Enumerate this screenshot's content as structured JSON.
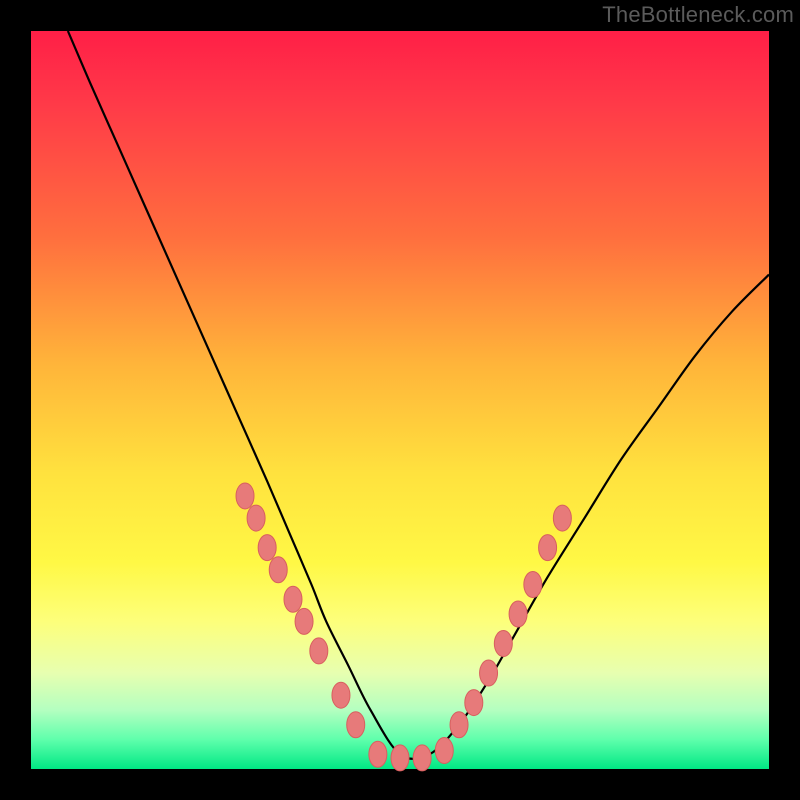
{
  "watermark": "TheBottleneck.com",
  "colors": {
    "frame": "#000000",
    "gradient_top": "#ff1f47",
    "gradient_mid": "#ffe23e",
    "gradient_bottom": "#00e884",
    "curve": "#000000",
    "marker_fill": "#e77a7a",
    "marker_stroke": "#d85f5f"
  },
  "chart_data": {
    "type": "line",
    "title": "",
    "xlabel": "",
    "ylabel": "",
    "xlim": [
      0,
      100
    ],
    "ylim": [
      0,
      100
    ],
    "curve": {
      "x": [
        5,
        8,
        12,
        16,
        20,
        24,
        28,
        32,
        35,
        38,
        40,
        43,
        46,
        50,
        54,
        58,
        62,
        66,
        70,
        75,
        80,
        85,
        90,
        95,
        100
      ],
      "y": [
        100,
        93,
        84,
        75,
        66,
        57,
        48,
        39,
        32,
        25,
        20,
        14,
        8,
        2,
        2,
        6,
        12,
        19,
        26,
        34,
        42,
        49,
        56,
        62,
        67
      ]
    },
    "series": [
      {
        "name": "markers-left",
        "type": "scatter",
        "x": [
          29,
          30.5,
          32,
          33.5,
          35.5,
          37,
          39,
          42,
          44
        ],
        "y": [
          37,
          34,
          30,
          27,
          23,
          20,
          16,
          10,
          6
        ]
      },
      {
        "name": "markers-bottom",
        "type": "scatter",
        "x": [
          47,
          50,
          53,
          56
        ],
        "y": [
          2,
          1.5,
          1.5,
          2.5
        ]
      },
      {
        "name": "markers-right",
        "type": "scatter",
        "x": [
          58,
          60,
          62,
          64,
          66,
          68,
          70,
          72
        ],
        "y": [
          6,
          9,
          13,
          17,
          21,
          25,
          30,
          34
        ]
      }
    ]
  }
}
